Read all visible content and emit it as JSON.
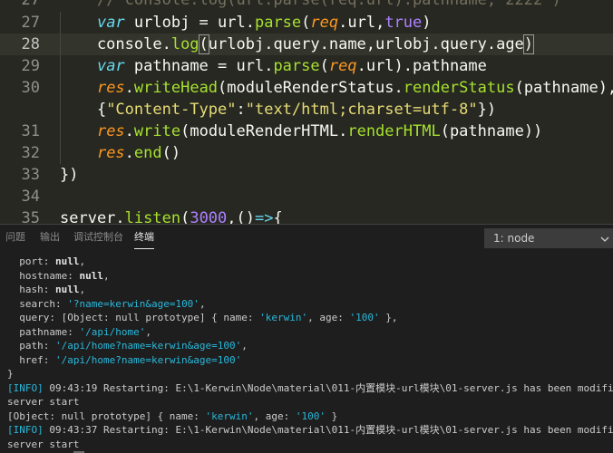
{
  "editor": {
    "lines": [
      {
        "no": "27",
        "html": "    <span class=\"cmt\">// console.log(url.parse(req.url).pathname, 2222 )</span>"
      },
      {
        "no": "26",
        "html": ""
      },
      {
        "no": "27",
        "html": "    <span class=\"kw\">var</span> urlobj = url.<span class=\"fn\">parse</span>(<span class=\"pm\">req</span>.url,<span class=\"num\">true</span>)"
      },
      {
        "no": "28",
        "html": "    console.<span class=\"fn\">log</span><span class=\"bm\">(</span>urlobj.query.name,urlobj.query.age<span class=\"bm\">)</span><span class=\"caret\"></span>"
      },
      {
        "no": "29",
        "html": "    <span class=\"kw\">var</span> pathname = url.<span class=\"fn\">parse</span>(<span class=\"pm\">req</span>.url).pathname"
      },
      {
        "no": "30",
        "html": "    <span class=\"pm\">res</span>.<span class=\"fn\">writeHead</span>(moduleRenderStatus.<span class=\"fn\">renderStatus</span>(pathname),"
      },
      {
        "no": "",
        "html": "    {<span class=\"str\">\"Content-Type\"</span>:<span class=\"str\">\"text/html;charset=utf-8\"</span>})"
      },
      {
        "no": "31",
        "html": "    <span class=\"pm\">res</span>.<span class=\"fn\">write</span>(moduleRenderHTML.<span class=\"fn\">renderHTML</span>(pathname))"
      },
      {
        "no": "32",
        "html": "    <span class=\"pm\">res</span>.<span class=\"fn\">end</span>()"
      },
      {
        "no": "33",
        "html": "})"
      },
      {
        "no": "34",
        "html": ""
      },
      {
        "no": "35",
        "html": "server.<span class=\"fn\">listen</span>(<span class=\"num\">3000</span>,()<span class=\"kw\">=&gt;</span>{"
      }
    ]
  },
  "panel": {
    "tabs": [
      "问题",
      "输出",
      "调试控制台",
      "终端"
    ],
    "active_tab": "终端",
    "terminal_select": "1: node"
  },
  "terminal": {
    "lines": [
      "  port: <b class=\"t-bold\">null</b>,",
      "  hostname: <b class=\"t-bold\">null</b>,",
      "  hash: <b class=\"t-bold\">null</b>,",
      "  search: <span class=\"t-str\">'?name=kerwin&amp;age=100'</span>,",
      "  query: [Object: null prototype] { name: <span class=\"t-str\">'kerwin'</span>, age: <span class=\"t-str\">'100'</span> },",
      "  pathname: <span class=\"t-str\">'/api/home'</span>,",
      "  path: <span class=\"t-str\">'/api/home?name=kerwin&amp;age=100'</span>,",
      "  href: <span class=\"t-str\">'/api/home?name=kerwin&amp;age=100'</span>",
      "}",
      "<span class=\"t-info\">[INFO]</span> 09:43:19 Restarting: E:\\1-Kerwin\\Node\\material\\011-内置模块-url模块\\01-server.js has been modified",
      "server start",
      "[Object: null prototype] { name: <span class=\"t-str\">'kerwin'</span>, age: <span class=\"t-str\">'100'</span> }",
      "<span class=\"t-info\">[INFO]</span> 09:43:37 Restarting: E:\\1-Kerwin\\Node\\material\\011-内置模块-url模块\\01-server.js has been modified",
      "server start",
      "kerwin 100 <span class=\"cursor-block\"></span>"
    ]
  }
}
